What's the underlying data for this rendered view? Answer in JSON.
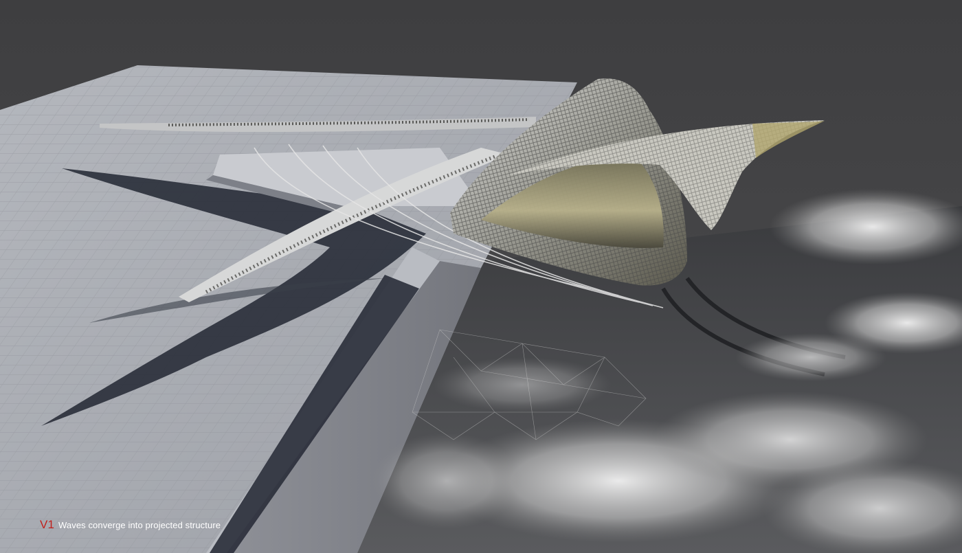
{
  "caption": {
    "code": "V1",
    "text": "Waves converge into projected structure"
  },
  "colors": {
    "background": "#444446",
    "caption_code": "#c0201c",
    "caption_text": "#ffffff",
    "platform": "#a9acb2",
    "shadow": "#262a36",
    "water_foam": "#dcdcdc"
  },
  "scene": {
    "subject": "architectural render of a wave-shaped shell structure projecting from a paved pier over foaming sea water"
  }
}
